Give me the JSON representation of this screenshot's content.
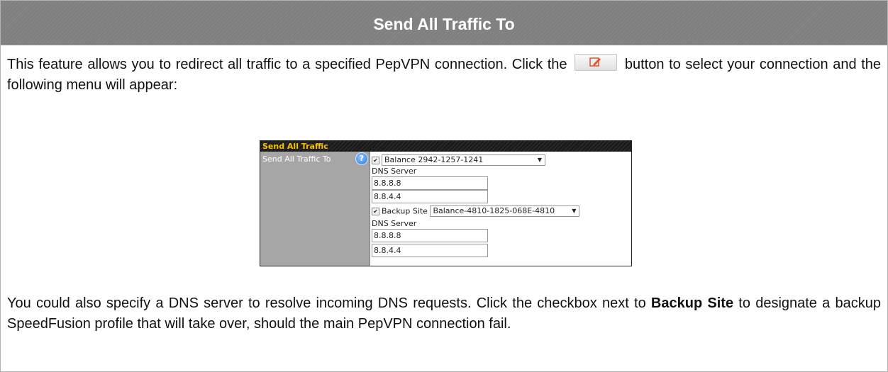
{
  "section": {
    "title": "Send All Traffic To"
  },
  "intro": {
    "before_button": "This feature allows you to redirect all traffic to a specified PepVPN connection. Click the",
    "after_button": "button to select your connection and the following menu will appear:",
    "button_icon": "edit-icon"
  },
  "panel": {
    "header": "Send All Traffic",
    "row_label": "Send All Traffic To",
    "help_symbol": "?",
    "primary": {
      "checked_mark": "✔",
      "select_value": "Balance 2942-1257-1241",
      "dns_label": "DNS Server",
      "dns1": "8.8.8.8",
      "dns2": "8.8.4.4"
    },
    "backup": {
      "checked_mark": "✔",
      "label": "Backup Site",
      "select_value": "Balance-4810-1825-068E-4810",
      "dns_label": "DNS Server",
      "dns1": "8.8.8.8",
      "dns2": "8.8.4.4"
    },
    "dropdown_arrow": "▼"
  },
  "outro": {
    "part1": "You could also specify a DNS server to resolve incoming DNS requests. Click the checkbox next to",
    "bold": "Backup Site",
    "part2": "to designate a backup SpeedFusion profile that will take over, should the main PepVPN connection fail."
  },
  "colors": {
    "header_bg": "#808080",
    "panel_header_text": "#f7c300",
    "label_col_bg": "#a6a6a6"
  }
}
